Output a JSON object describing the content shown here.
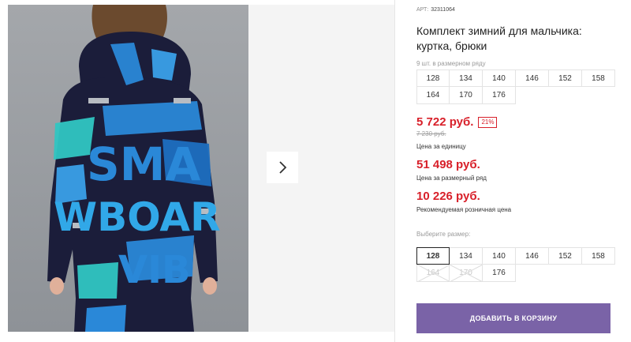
{
  "product": {
    "article_prefix": "АРТ:",
    "article_number": "32311064",
    "title": "Комплект зимний для мальчика: куртка, брюки",
    "row_count": "9 шт. в размерном ряду",
    "row_sizes": [
      "128",
      "134",
      "140",
      "146",
      "152",
      "158",
      "164",
      "170",
      "176"
    ]
  },
  "pricing": {
    "unit_price": "5 722 руб.",
    "discount": "21%",
    "old_price": "7 230 руб.",
    "unit_label": "Цена за единицу",
    "row_price": "51 498 руб.",
    "row_label": "Цена за размерный ряд",
    "rrp_price": "10 226 руб.",
    "rrp_label": "Рекомендуемая розничная цена"
  },
  "size_picker": {
    "label": "Выберите размер:",
    "selected": "128",
    "options": [
      {
        "size": "128",
        "state": "selected"
      },
      {
        "size": "134",
        "state": "available"
      },
      {
        "size": "140",
        "state": "available"
      },
      {
        "size": "146",
        "state": "available"
      },
      {
        "size": "152",
        "state": "available"
      },
      {
        "size": "158",
        "state": "available"
      },
      {
        "size": "164",
        "state": "unavailable"
      },
      {
        "size": "170",
        "state": "unavailable"
      },
      {
        "size": "176",
        "state": "available"
      }
    ]
  },
  "actions": {
    "add_to_cart": "ДОБАВИТЬ В КОРЗИНУ"
  },
  "gallery": {
    "next_icon": "chevron-right-icon",
    "photo_lettering": [
      "SMA",
      "WBOAR",
      "VIB"
    ]
  },
  "colors": {
    "price": "#d8202a",
    "cart_button": "#7a63a7",
    "jacket_base": "#1b1d3a",
    "print_blue": "#2a88d8",
    "print_teal": "#31c6c2"
  }
}
